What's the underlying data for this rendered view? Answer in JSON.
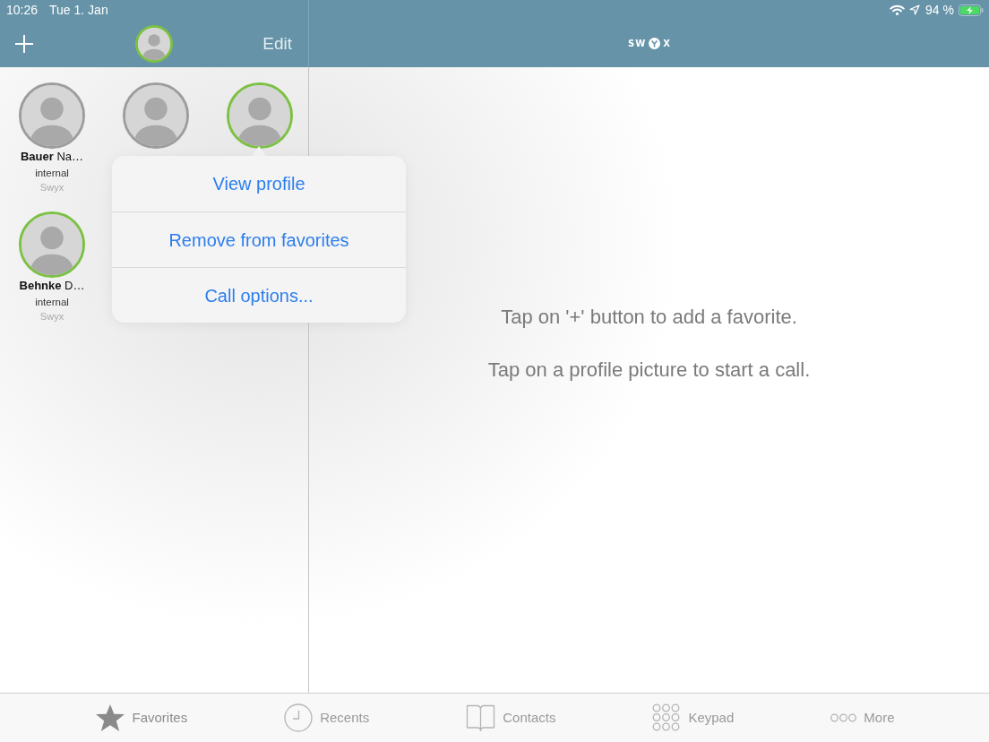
{
  "status_bar": {
    "time": "10:26",
    "date": "Tue 1. Jan",
    "battery": "94 %"
  },
  "nav_bar": {
    "profile_avatar": {
      "color": "#7dc143"
    },
    "edit_button": "Edit",
    "logo": {
      "text_before": "SW",
      "text_after": "X"
    }
  },
  "favorites": [
    {
      "name": "**Bauer** Na…",
      "subtitle": "internal",
      "caption": "Swyx",
      "color": "#9d9d9d"
    },
    {
      "color": "#9d9d9d"
    },
    {
      "color": "#7dc143"
    },
    {
      "name": "**Behnke** D…",
      "subtitle": "internal",
      "caption": "Swyx",
      "color": "#7dc143"
    }
  ],
  "popover": {
    "items": [
      "View profile",
      "Remove from favorites",
      "Call options..."
    ]
  },
  "message": {
    "lines": [
      "Tap on '+' button to add a favorite.",
      "Tap on a profile picture to start a call."
    ]
  },
  "tab_bar": {
    "items": [
      {
        "label": "Favorites",
        "kind": "star",
        "selected": true
      },
      {
        "label": "Recents",
        "kind": "clock",
        "selected": false
      },
      {
        "label": "Contacts",
        "kind": "book",
        "selected": false
      },
      {
        "label": "Keypad",
        "kind": "keypad",
        "selected": false
      },
      {
        "label": "More",
        "kind": "dots",
        "selected": false
      }
    ]
  }
}
